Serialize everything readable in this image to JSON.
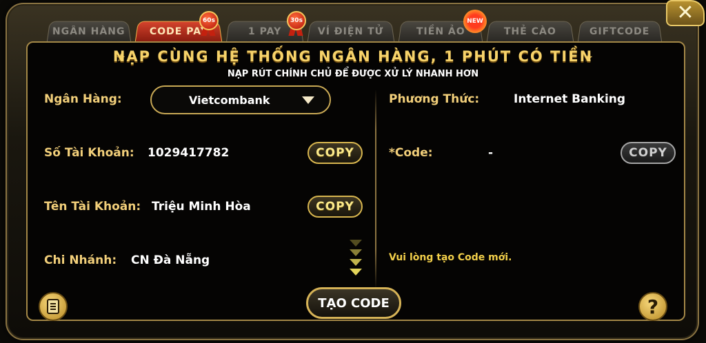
{
  "tabs": [
    {
      "label": "NGÂN HÀNG",
      "active": false
    },
    {
      "label": "CODE PAY",
      "active": true,
      "badge": "60s"
    },
    {
      "label": "1 PAY",
      "active": false,
      "badge": "30s"
    },
    {
      "label": "VÍ ĐIỆN TỬ",
      "active": false
    },
    {
      "label": "TIỀN ẢO",
      "active": false,
      "badge": "NEW"
    },
    {
      "label": "THẺ CÀO",
      "active": false
    },
    {
      "label": "GIFTCODE",
      "active": false
    }
  ],
  "header": {
    "title": "NẠP CÙNG HỆ THỐNG NGÂN HÀNG, 1 PHÚT CÓ TIỀN",
    "subtitle": "NẠP RÚT CHÍNH CHỦ ĐỂ ĐƯỢC XỬ LÝ NHANH HƠN"
  },
  "left": {
    "bank_label": "Ngân Hàng:",
    "bank_selected": "Vietcombank",
    "account_number_label": "Số Tài Khoản:",
    "account_number": "1029417782",
    "account_name_label": "Tên Tài Khoản:",
    "account_name": "Triệu Minh Hòa",
    "branch_label": "Chi Nhánh:",
    "branch": "CN Đà Nẵng",
    "copy_label": "COPY"
  },
  "right": {
    "method_label": "Phương Thức:",
    "method": "Internet Banking",
    "code_label": "*Code:",
    "code_value": "-",
    "copy_label": "COPY",
    "hint": "Vui lòng tạo Code mới."
  },
  "actions": {
    "create_code": "TẠO CODE",
    "help": "?"
  },
  "icons": {
    "close": "close-icon",
    "history": "document-icon",
    "help": "help-icon",
    "scroll": "chevron-down-icon"
  },
  "colors": {
    "gold": "#f2cf7a",
    "active_tab": "#d5432d",
    "hint": "#f2cf4a"
  }
}
